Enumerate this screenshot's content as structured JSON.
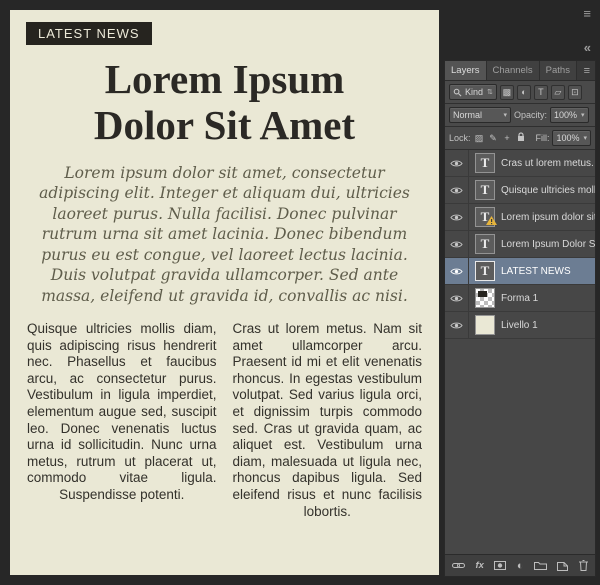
{
  "document": {
    "badge": "LATEST NEWS",
    "headline_line1": "Lorem Ipsum",
    "headline_line2": "Dolor Sit Amet",
    "intro": "Lorem ipsum dolor sit amet, consectetur adipiscing elit. Integer et aliquam dui, ultricies laoreet purus. Nulla facilisi. Donec pulvinar rutrum urna sit amet lacinia. Donec bibendum purus eu est congue, vel laoreet lectus lacinia. Duis volutpat gravida ullamcorper. Sed ante massa, eleifend ut gravida id, convallis ac nisi.",
    "column_left": "Quisque ultricies mollis diam, quis adipiscing risus hendrerit nec. Phasellus et faucibus arcu, ac consectetur purus. Vestibulum in ligula imperdiet, elementum augue sed, suscipit leo. Donec venenatis luctus urna id sollicitudin. Nunc urna metus, rutrum ut placerat ut, commodo vitae ligula. Suspendisse potenti.",
    "column_right": "Cras ut lorem metus. Nam sit amet ullamcorper arcu. Praesent id mi et elit venenatis rhoncus. In egestas vestibulum volutpat. Sed varius ligula orci, et dignissim turpis commodo sed. Cras ut gravida quam, ac aliquet est. Vestibulum urna diam, malesuada ut ligula nec, rhoncus dapibus ligula. Sed eleifend risus et nunc facilisis lobortis."
  },
  "panel": {
    "tabs": [
      "Layers",
      "Channels",
      "Paths"
    ],
    "filter": {
      "kind_label": "Kind"
    },
    "blend": {
      "mode": "Normal",
      "opacity_label": "Opacity:",
      "opacity_value": "100%"
    },
    "lock": {
      "label": "Lock:",
      "fill_label": "Fill:",
      "fill_value": "100%"
    },
    "layers": [
      {
        "name": "Cras ut lorem metus. N...",
        "type": "text"
      },
      {
        "name": "Quisque ultricies mollis...",
        "type": "text"
      },
      {
        "name": "Lorem ipsum dolor sit a...",
        "type": "text",
        "warning": true
      },
      {
        "name": "Lorem Ipsum Dolor Sit ...",
        "type": "text"
      },
      {
        "name": "LATEST NEWS",
        "type": "text",
        "selected": true
      },
      {
        "name": "Forma 1",
        "type": "shape"
      },
      {
        "name": "Livello 1",
        "type": "fill"
      }
    ],
    "bottom": {
      "fx_label": "fx"
    }
  },
  "icons": {
    "workspace_menu": "≡",
    "collapse_panels": "«",
    "panel_menu": "≡",
    "kind_spinner": "⇅",
    "filter_pixel": "▩",
    "filter_adjustment": "◐",
    "filter_type": "T",
    "filter_shape": "▱",
    "filter_smart": "⊡",
    "dropdown_arrow": "▾",
    "lock_transparency": "▨",
    "lock_brush": "✎",
    "lock_move": "+",
    "adjustment_glyph": "◐",
    "type_thumb": "T"
  },
  "colors": {
    "canvas_bg": "#eae8d5",
    "panel_bg": "#474747",
    "selected_layer": "#6c7d93",
    "warning": "#e6b43c"
  }
}
